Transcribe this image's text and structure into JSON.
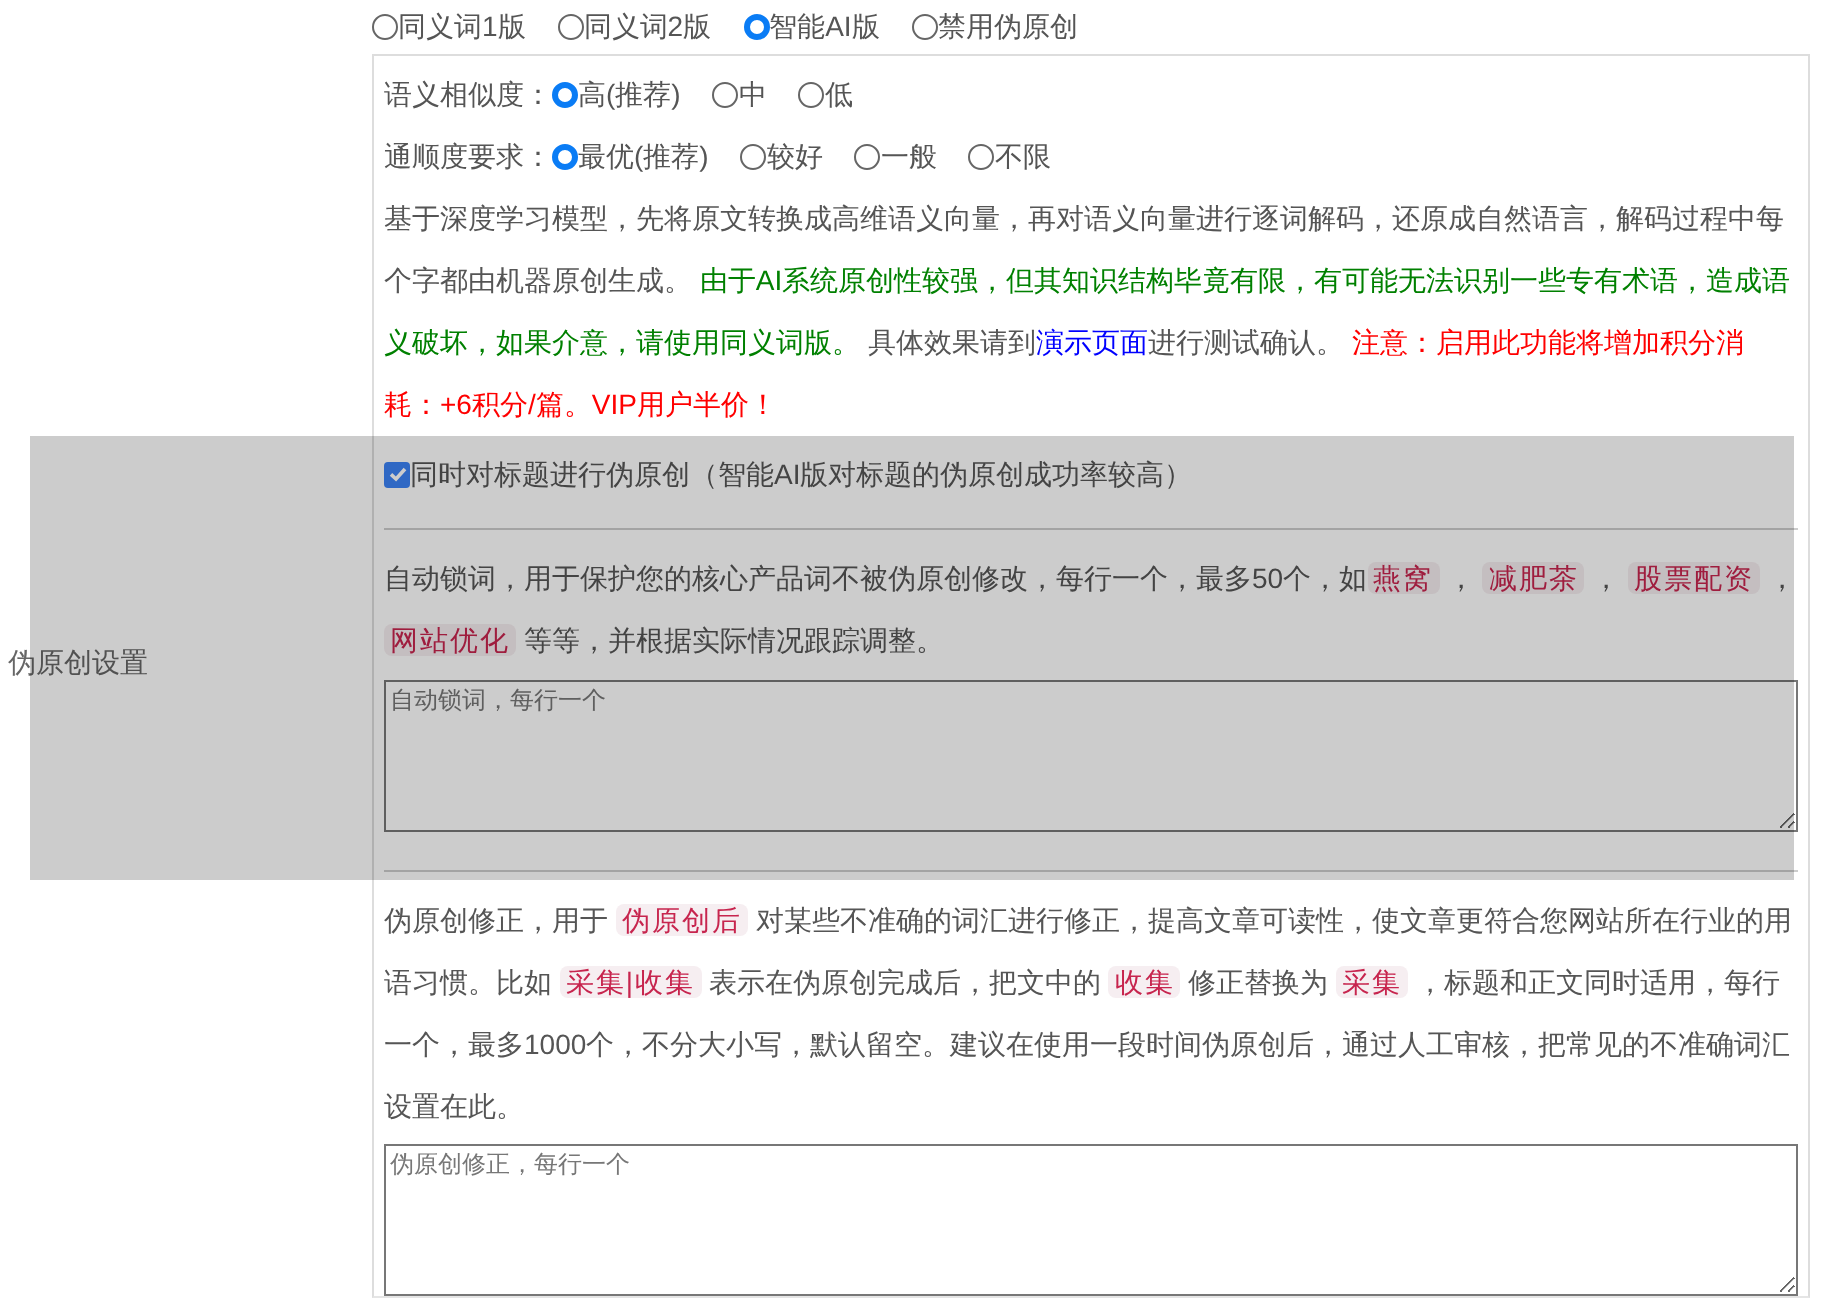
{
  "mode_options": [
    {
      "label": "同义词1版",
      "selected": false
    },
    {
      "label": "同义词2版",
      "selected": false
    },
    {
      "label": "智能AI版",
      "selected": true
    },
    {
      "label": "禁用伪原创",
      "selected": false
    }
  ],
  "settings_label": "伪原创设置",
  "similarity": {
    "label": "语义相似度：",
    "options": [
      {
        "label": "高(推荐)",
        "selected": true
      },
      {
        "label": "中",
        "selected": false
      },
      {
        "label": "低",
        "selected": false
      }
    ]
  },
  "fluency": {
    "label": "通顺度要求：",
    "options": [
      {
        "label": "最优(推荐)",
        "selected": true
      },
      {
        "label": "较好",
        "selected": false
      },
      {
        "label": "一般",
        "selected": false
      },
      {
        "label": "不限",
        "selected": false
      }
    ]
  },
  "ai_description": [
    {
      "kind": "text",
      "text": "基于深度学习模型，先将原文转换成高维语义向量，再对语义向量进行逐词解码，还原成自然语言，解码过程中每个字都由机器原创生成。 "
    },
    {
      "kind": "note",
      "text": "由于AI系统原创性较强，但其知识结构毕竟有限，有可能无法识别一些专有术语，造成语义破坏，如果介意，请使用同义词版。"
    },
    {
      "kind": "text",
      "text": " 具体效果请到"
    },
    {
      "kind": "link",
      "text": "演示页面"
    },
    {
      "kind": "text",
      "text": "进行测试确认。 "
    },
    {
      "kind": "warning",
      "text": "注意：启用此功能将增加积分消耗：+6积分/篇。VIP用户半价！"
    }
  ],
  "title_option": {
    "label": "同时对标题进行伪原创（智能AI版对标题的伪原创成功率较高）",
    "checked": true
  },
  "lock_words": {
    "description": [
      {
        "kind": "text",
        "text": "自动锁词，用于保护您的核心产品词不被伪原创修改，每行一个，最多50个，如"
      },
      {
        "kind": "tag",
        "text": "燕窝"
      },
      {
        "kind": "text",
        "text": " ， "
      },
      {
        "kind": "tag",
        "text": "减肥茶"
      },
      {
        "kind": "text",
        "text": " ， "
      },
      {
        "kind": "tag",
        "text": "股票配资"
      },
      {
        "kind": "text",
        "text": " ， "
      },
      {
        "kind": "tag",
        "text": "网站优化"
      },
      {
        "kind": "text",
        "text": " 等等，并根据实际情况跟踪调整。"
      }
    ],
    "placeholder": "自动锁词，每行一个"
  },
  "correction": {
    "description": [
      {
        "kind": "text",
        "text": "伪原创修正，用于 "
      },
      {
        "kind": "tag",
        "text": "伪原创后"
      },
      {
        "kind": "text",
        "text": " 对某些不准确的词汇进行修正，提高文章可读性，使文章更符合您网站所在行业的用语习惯。比如 "
      },
      {
        "kind": "tag",
        "text": "采集|收集"
      },
      {
        "kind": "text",
        "text": " 表示在伪原创完成后，把文中的 "
      },
      {
        "kind": "tag",
        "text": "收集"
      },
      {
        "kind": "text",
        "text": " 修正替换为 "
      },
      {
        "kind": "tag",
        "text": "采集"
      },
      {
        "kind": "text",
        "text": " ，标题和正文同时适用，每行一个，最多1000个，不分大小写，默认留空。建议在使用一段时间伪原创后，通过人工审核，把常见的不准确词汇设置在此。"
      }
    ],
    "placeholder": "伪原创修正，每行一个"
  }
}
